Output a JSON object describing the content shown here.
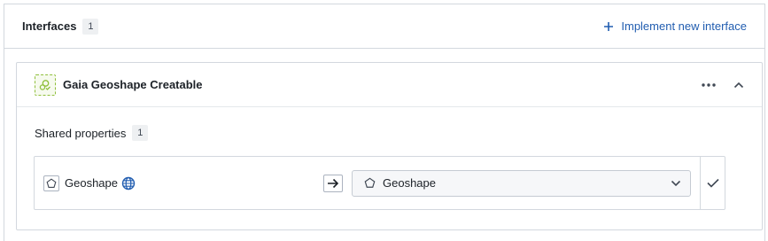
{
  "header": {
    "title": "Interfaces",
    "count": "1",
    "implement_label": "Implement new interface"
  },
  "interface": {
    "name": "Gaia Geoshape Creatable",
    "shared_properties_label": "Shared properties",
    "shared_properties_count": "1",
    "property": {
      "name": "Geoshape",
      "mapped_value": "Geoshape"
    }
  },
  "colors": {
    "accent": "#215db0",
    "interface_icon": "#8fbf3b"
  }
}
